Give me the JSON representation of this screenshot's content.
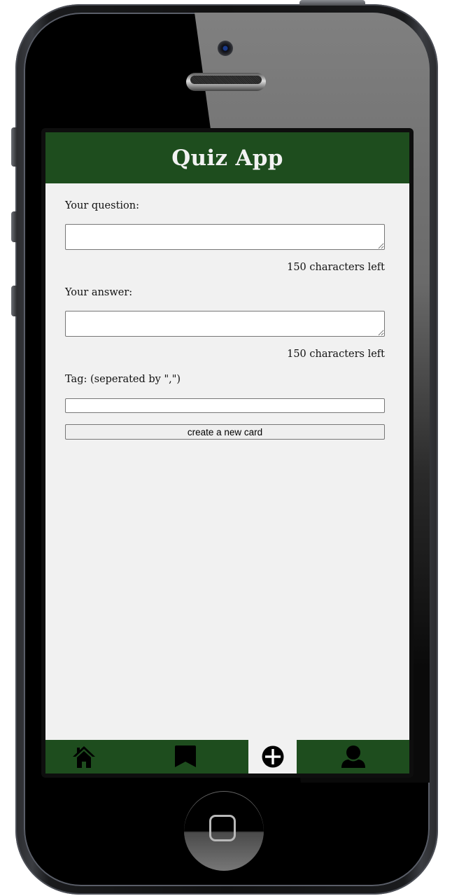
{
  "app": {
    "title": "Quiz App",
    "accent_color": "#1e4d1e",
    "background_color": "#f1f1f1"
  },
  "form": {
    "question": {
      "label": "Your question:",
      "value": "",
      "counter": "150 characters left"
    },
    "answer": {
      "label": "Your answer:",
      "value": "",
      "counter": "150 characters left"
    },
    "tag": {
      "label": "Tag: (seperated by \",\")",
      "value": ""
    },
    "submit_label": "create a new card"
  },
  "bottom_nav": {
    "items": [
      {
        "icon": "home-icon",
        "active": false
      },
      {
        "icon": "bookmark-icon",
        "active": false
      },
      {
        "icon": "plus-circle-icon",
        "active": true
      },
      {
        "icon": "user-icon",
        "active": false
      }
    ]
  }
}
